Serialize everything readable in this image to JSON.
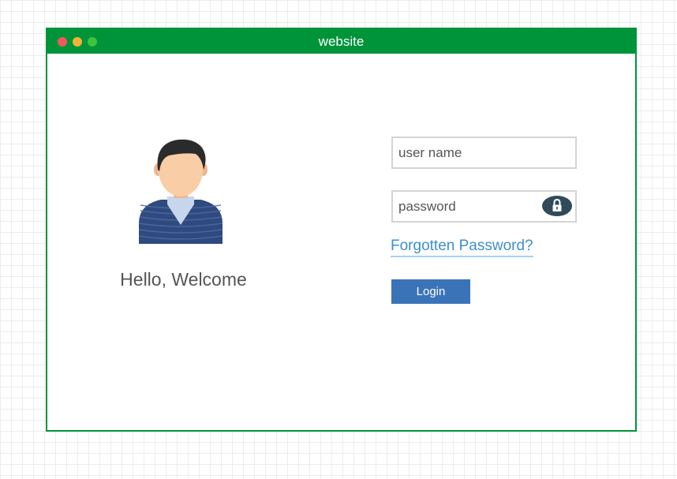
{
  "window": {
    "title": "website",
    "controls": [
      "close",
      "minimize",
      "maximize"
    ]
  },
  "profile": {
    "icon": "user-avatar-icon",
    "greeting": "Hello, Welcome"
  },
  "form": {
    "username_placeholder": "user name",
    "password_placeholder": "password",
    "password_icon": "lock-icon",
    "forgot_label": "Forgotten Password?",
    "login_label": "Login"
  },
  "colors": {
    "titlebar": "#00943a",
    "login_button": "#3b73b9",
    "link": "#3b8fd0",
    "lock_button": "#2f4b5a"
  }
}
